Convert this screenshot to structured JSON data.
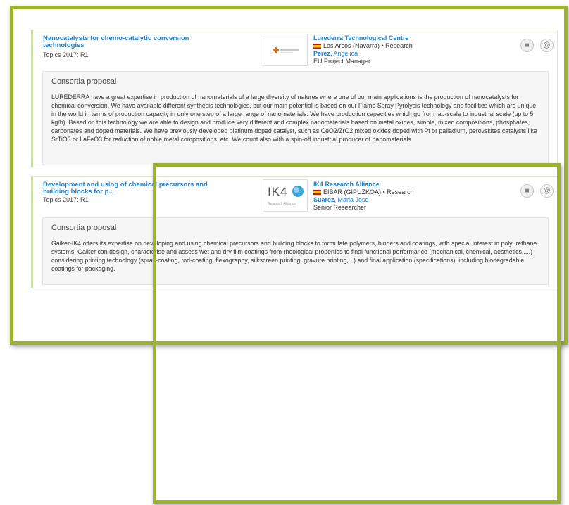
{
  "cards": [
    {
      "title": "Nanocatalysts for chemo-catalytic conversion technologies",
      "topics": "Topics 2017: R1",
      "org_name": "Lurederra Technological Centre",
      "org_location": "Los Arcos (Navarra) • Research",
      "person_last": "Perez,",
      "person_first": "Angelica",
      "role": "EU Project Manager",
      "proposal_heading": "Consortia proposal",
      "proposal_text": "LUREDERRA have a great expertise in production of nanomaterials of a large diversity of natures where one of our main applications is the production of nanocatalysts for chemical conversion. We have available different synthesis technologies, but our main potential is based on our Flame Spray Pyrolysis technology and facilities which are unique in the world in terms of production capacity in only one step of a large range of nanomaterials. We have production capacities which go from lab-scale to industrial scale (up to 5 kg/h). Based on this technology we are able to design and produce very different and complex nanomaterials based on metal oxides, simple, mixed compositions, phosphates, carbonates and doped materials. We have previously developed platinum doped catalyst, such as CeO2/ZrO2 mixed oxides doped with Pt or palladium, perovskites catalysts like SrTiO3 or LaFeO3 for reduction of noble metal compositions, etc. We count also with a spin-off industrial producer of nanomaterials"
    },
    {
      "title": "Development and using of chemical precursors and building blocks for p...",
      "topics": "Topics 2017: R1",
      "logo_text": "IK4",
      "logo_subtext": "Research Alliance",
      "org_name": "IK4 Research Alliance",
      "org_location": "EIBAR (GIPUZKOA) • Research",
      "person_last": "Suarez,",
      "person_first": "Maria Jose",
      "role": "Senior Researcher",
      "proposal_heading": "Consortia proposal",
      "proposal_text": "Gaiker-IK4 offers its expertise on developing and using chemical precursors and building blocks to formulate polymers, binders and coatings, with special interest in polyurethane systems. Gaiker can design, characterise and assess wet and dry film coatings from rheological properties to final functional performance (mechanical, chemical, aesthetics,....) considering printing technology (spray-coating, rod-coating, flexography, silkscreen printing, gravure printing,...) and final application (specifications), including biodegradable coatings for packaging."
    }
  ],
  "icons": {
    "folder": "folder-icon",
    "email": "at-sign-icon"
  },
  "colors": {
    "highlight": "#9db22f",
    "link": "#2b7fbd"
  }
}
